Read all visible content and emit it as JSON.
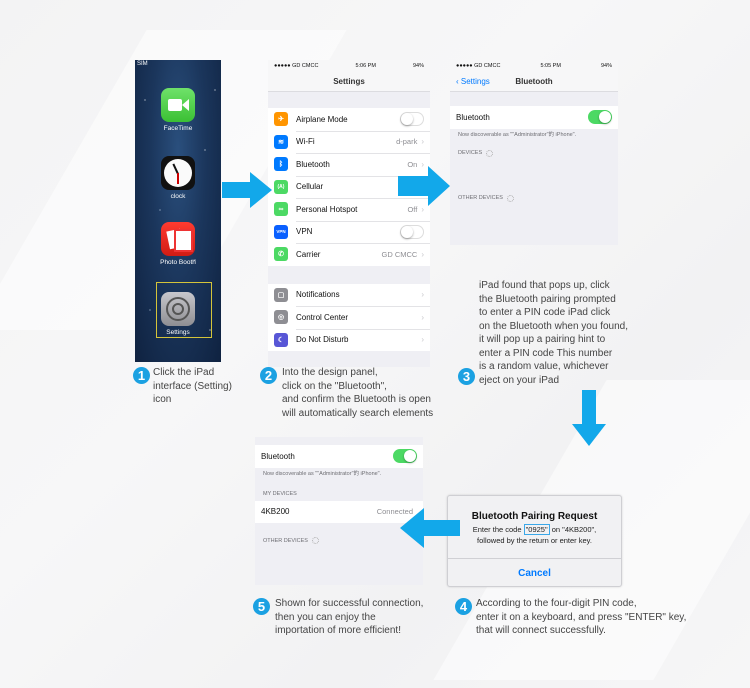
{
  "home_screen": {
    "status": "SIM",
    "apps": [
      {
        "label": "FaceTime"
      },
      {
        "label": "clock"
      },
      {
        "label": "Photo Booth"
      },
      {
        "label": "Settings"
      }
    ]
  },
  "settings_screen": {
    "status": {
      "carrier": "●●●●● GD CMCC",
      "time": "5:06 PM",
      "battery": "94%"
    },
    "title": "Settings",
    "group1": [
      {
        "label": "Airplane Mode",
        "value": "",
        "icon": "airplane-icon",
        "color": "#ff9500",
        "glyph": "✈",
        "toggle": "off"
      },
      {
        "label": "Wi-Fi",
        "value": "d-park",
        "icon": "wifi-icon",
        "color": "#007aff",
        "glyph": "≋"
      },
      {
        "label": "Bluetooth",
        "value": "On",
        "icon": "bluetooth-icon",
        "color": "#007aff",
        "glyph": "ᛒ"
      },
      {
        "label": "Cellular",
        "value": "",
        "icon": "cellular-icon",
        "color": "#4cd964",
        "glyph": "(A)"
      },
      {
        "label": "Personal Hotspot",
        "value": "Off",
        "icon": "hotspot-icon",
        "color": "#4cd964",
        "glyph": "∞"
      },
      {
        "label": "VPN",
        "value": "",
        "icon": "vpn-icon",
        "color": "#0a60ff",
        "glyph": "VPN",
        "toggle": "off"
      },
      {
        "label": "Carrier",
        "value": "GD CMCC",
        "icon": "phone-icon",
        "color": "#4cd964",
        "glyph": "✆"
      }
    ],
    "group2": [
      {
        "label": "Notifications",
        "icon": "notifications-icon",
        "color": "#8e8e93",
        "glyph": "▢"
      },
      {
        "label": "Control Center",
        "icon": "control-center-icon",
        "color": "#8e8e93",
        "glyph": "◎"
      },
      {
        "label": "Do Not Disturb",
        "icon": "moon-icon",
        "color": "#5856d6",
        "glyph": "☾"
      }
    ]
  },
  "bluetooth_screen": {
    "status": {
      "carrier": "●●●●● GD CMCC",
      "time": "5:05 PM",
      "battery": "94%"
    },
    "back_label": "Settings",
    "title": "Bluetooth",
    "toggle_label": "Bluetooth",
    "toggle_state": "on",
    "discoverable_note": "Now discoverable as \"\"Administrator\"的 iPhone\".",
    "devices_header": "DEVICES",
    "other_devices_header": "OTHER DEVICES"
  },
  "connected_screen": {
    "toggle_label": "Bluetooth",
    "discoverable_note": "Now discoverable as \"\"Administrator\"的 iPhone\".",
    "my_devices_header": "MY DEVICES",
    "device_name": "4KB200",
    "device_status": "Connected",
    "other_devices_header": "OTHER DEVICES"
  },
  "pairing_dialog": {
    "title": "Bluetooth Pairing Request",
    "msg_prefix": "Enter the code",
    "code": "\"0925\"",
    "msg_suffix": "on \"4KB200\",",
    "msg_line2": "followed by the return or enter key.",
    "cancel_label": "Cancel"
  },
  "steps": [
    {
      "num": "1",
      "text": [
        "Click the iPad",
        "interface (Setting)",
        "icon"
      ]
    },
    {
      "num": "2",
      "text": [
        "Into the design panel,",
        "click on the \"Bluetooth\",",
        "and confirm the Bluetooth is open",
        "will automatically search elements"
      ]
    },
    {
      "num": "3",
      "text": [
        "iPad found that pops up, click",
        "the Bluetooth pairing prompted",
        "to enter a PIN code iPad click",
        "on the Bluetooth when you found,",
        "it will pop up a pairing hint to",
        "enter a PIN code This number",
        "is a random value, whichever",
        "eject on your iPad"
      ]
    },
    {
      "num": "4",
      "text": [
        "According to the four-digit PIN code,",
        "enter it on a keyboard, and press \"ENTER\" key,",
        "that will connect successfully."
      ]
    },
    {
      "num": "5",
      "text": [
        "Shown for successful connection,",
        "then you can enjoy the",
        "importation of more efficient!"
      ]
    }
  ],
  "colors": {
    "accent": "#1ba1e2",
    "arrow": "#0aa4e8",
    "ios_green": "#4cd964",
    "ios_blue": "#007aff"
  }
}
